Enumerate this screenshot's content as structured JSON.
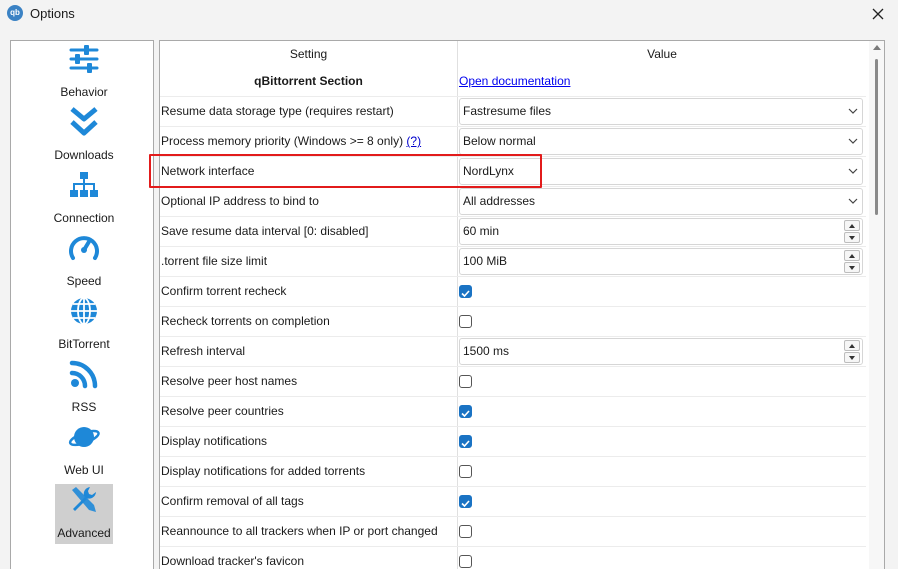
{
  "window": {
    "title": "Options",
    "app_icon_text": "qb"
  },
  "sidebar": {
    "items": [
      {
        "label": "Behavior",
        "icon": "sliders-icon"
      },
      {
        "label": "Downloads",
        "icon": "double-chevron-down-icon"
      },
      {
        "label": "Connection",
        "icon": "network-tree-icon"
      },
      {
        "label": "Speed",
        "icon": "speedometer-icon"
      },
      {
        "label": "BitTorrent",
        "icon": "globe-icon"
      },
      {
        "label": "RSS",
        "icon": "rss-icon"
      },
      {
        "label": "Web UI",
        "icon": "planet-icon"
      },
      {
        "label": "Advanced",
        "icon": "tools-icon",
        "active": true
      }
    ]
  },
  "table": {
    "headers": {
      "setting": "Setting",
      "value": "Value"
    },
    "section": {
      "title": "qBittorrent Section",
      "link": "Open documentation"
    },
    "rows": [
      {
        "setting": "Resume data storage type (requires restart)",
        "type": "combo",
        "value": "Fastresume files"
      },
      {
        "setting": "Process memory priority (Windows >= 8 only)",
        "help": "(?)",
        "type": "combo",
        "value": "Below normal"
      },
      {
        "setting": "Network interface",
        "type": "combo",
        "value": "NordLynx"
      },
      {
        "setting": "Optional IP address to bind to",
        "type": "combo",
        "value": "All addresses"
      },
      {
        "setting": "Save resume data interval [0: disabled]",
        "type": "spin",
        "value": "60 min"
      },
      {
        "setting": ".torrent file size limit",
        "type": "spin",
        "value": "100 MiB"
      },
      {
        "setting": "Confirm torrent recheck",
        "type": "check",
        "checked": true
      },
      {
        "setting": "Recheck torrents on completion",
        "type": "check",
        "checked": false
      },
      {
        "setting": "Refresh interval",
        "type": "spin",
        "value": "1500 ms"
      },
      {
        "setting": "Resolve peer host names",
        "type": "check",
        "checked": false
      },
      {
        "setting": "Resolve peer countries",
        "type": "check",
        "checked": true
      },
      {
        "setting": "Display notifications",
        "type": "check",
        "checked": true
      },
      {
        "setting": "Display notifications for added torrents",
        "type": "check",
        "checked": false
      },
      {
        "setting": "Confirm removal of all tags",
        "type": "check",
        "checked": true
      },
      {
        "setting": "Reannounce to all trackers when IP or port changed",
        "type": "check",
        "checked": false
      },
      {
        "setting": "Download tracker's favicon",
        "type": "check",
        "checked": false
      }
    ]
  },
  "colors": {
    "accent": "#1a73c4",
    "highlight": "#e21b1b",
    "icon_blue": "#1e88d8"
  }
}
